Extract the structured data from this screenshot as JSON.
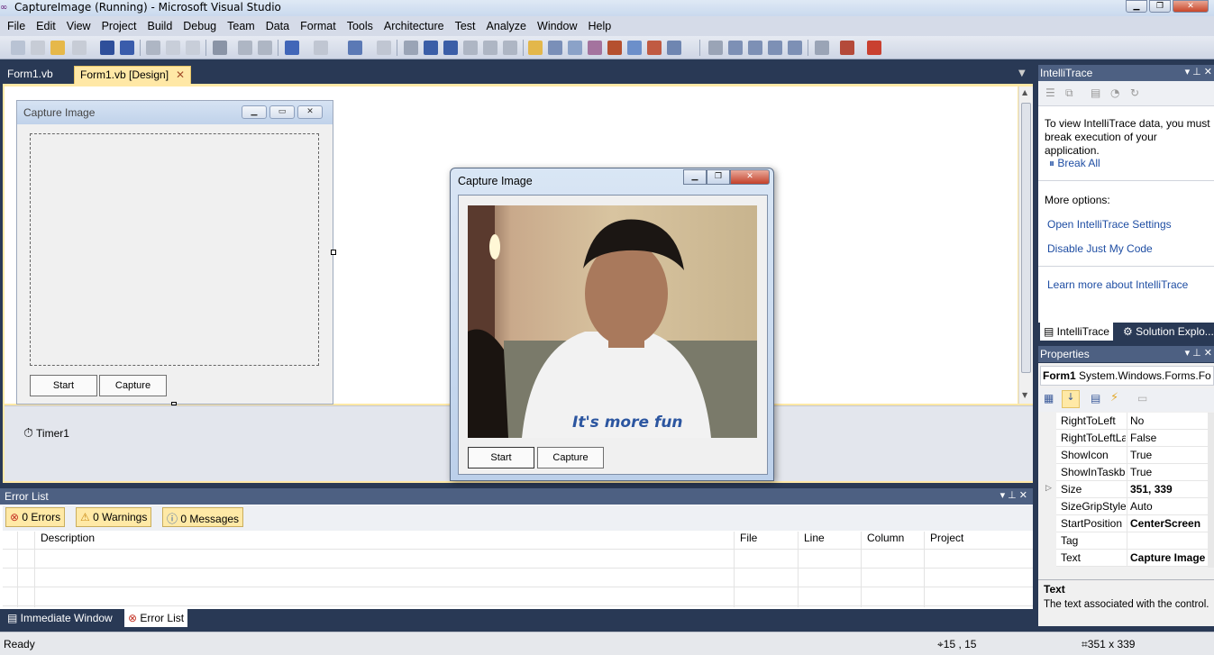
{
  "window": {
    "title": "CaptureImage (Running) - Microsoft Visual Studio"
  },
  "menu": [
    "File",
    "Edit",
    "View",
    "Project",
    "Build",
    "Debug",
    "Team",
    "Data",
    "Format",
    "Tools",
    "Architecture",
    "Test",
    "Analyze",
    "Window",
    "Help"
  ],
  "doc_tabs": [
    {
      "label": "Form1.vb"
    },
    {
      "label": "Form1.vb [Design]"
    }
  ],
  "design_form": {
    "title": "Capture Image",
    "start_label": "Start",
    "capture_label": "Capture"
  },
  "tray": {
    "timer_label": "Timer1"
  },
  "running_form": {
    "title": "Capture Image",
    "start_label": "Start",
    "capture_label": "Capture"
  },
  "intellitrace": {
    "title": "IntelliTrace",
    "message": "To view IntelliTrace data, you must break execution of your application.",
    "break_all": "Break All",
    "more_options": "More options:",
    "open_settings": "Open IntelliTrace Settings",
    "disable_jmc": "Disable Just My Code",
    "learn_more": "Learn more about IntelliTrace",
    "tab_intellitrace": "IntelliTrace",
    "tab_solution": "Solution Explo..."
  },
  "properties": {
    "title": "Properties",
    "object": "Form1",
    "object_type": "System.Windows.Forms.Fo",
    "rows": [
      {
        "name": "RightToLeft",
        "value": "No"
      },
      {
        "name": "RightToLeftLa",
        "value": "False"
      },
      {
        "name": "ShowIcon",
        "value": "True"
      },
      {
        "name": "ShowInTaskb",
        "value": "True"
      },
      {
        "name": "Size",
        "value": "351, 339"
      },
      {
        "name": "SizeGripStyle",
        "value": "Auto"
      },
      {
        "name": "StartPosition",
        "value": "CenterScreen"
      },
      {
        "name": "Tag",
        "value": ""
      },
      {
        "name": "Text",
        "value": "Capture Image"
      }
    ],
    "desc_title": "Text",
    "desc_text": "The text associated with the control."
  },
  "error_list": {
    "title": "Error List",
    "errors": "0 Errors",
    "warnings": "0 Warnings",
    "messages": "0 Messages",
    "columns": [
      "Description",
      "File",
      "Line",
      "Column",
      "Project"
    ]
  },
  "bottom_tabs": {
    "immediate": "Immediate Window",
    "errorlist": "Error List"
  },
  "status": {
    "text": "Ready",
    "position": "15 , 15",
    "size": "351 x 339"
  }
}
